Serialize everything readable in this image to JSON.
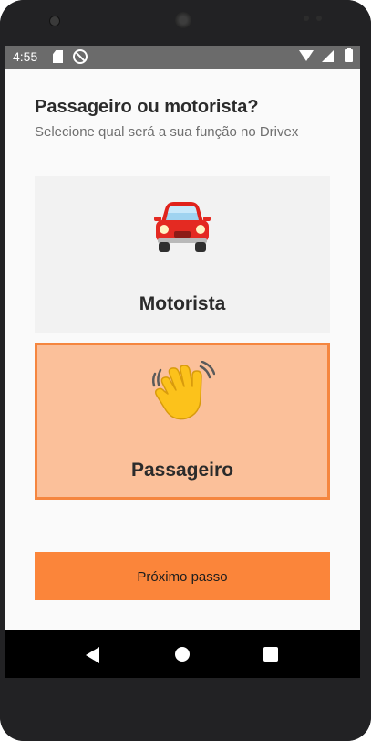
{
  "status_bar": {
    "time": "4:55",
    "icons": [
      "sd-card-icon",
      "no-sync-icon",
      "wifi-icon",
      "signal-icon",
      "battery-icon"
    ]
  },
  "header": {
    "title": "Passageiro ou motorista?",
    "subtitle": "Selecione qual será a sua função no Drivex"
  },
  "options": [
    {
      "label": "Motorista",
      "icon": "car-icon",
      "selected": false
    },
    {
      "label": "Passageiro",
      "icon": "waving-hand-icon",
      "selected": true
    }
  ],
  "next_button": {
    "label": "Próximo passo"
  },
  "nav_bar": {
    "buttons": [
      "back-icon",
      "home-icon",
      "recents-icon"
    ]
  },
  "colors": {
    "accent": "#fb853a",
    "selected_bg": "#fbc09a",
    "selected_border": "#f5863f",
    "card_bg": "#f2f2f2",
    "status_bar_bg": "#6b6b6b"
  }
}
